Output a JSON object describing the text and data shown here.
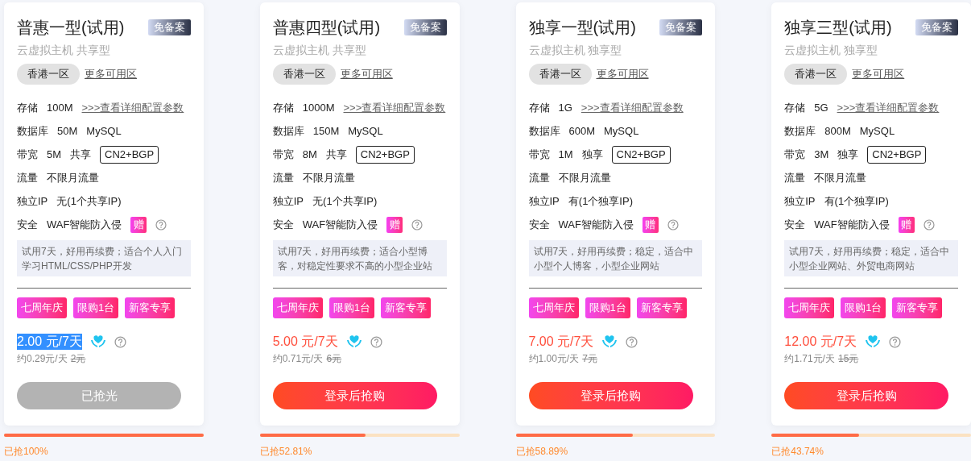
{
  "plans": [
    {
      "title": "普惠一型(试用)",
      "badge": "免备案",
      "subtitle": "云虚拟主机 共享型",
      "zone": "香港一区",
      "more_zones": "更多可用区",
      "specs": [
        {
          "label": "存储",
          "values": [
            "100M"
          ],
          "link": ">>>查看详细配置参数"
        },
        {
          "label": "数据库",
          "values": [
            "50M",
            "MySQL"
          ]
        },
        {
          "label": "带宽",
          "values": [
            "5M",
            "共享"
          ],
          "tag": "CN2+BGP"
        },
        {
          "label": "流量",
          "values": [
            "不限月流量"
          ]
        },
        {
          "label": "独立IP",
          "values": [
            "无(1个共享IP)"
          ]
        },
        {
          "label": "安全",
          "values": [
            "WAF智能防入侵"
          ],
          "gift": "赠"
        }
      ],
      "description": "试用7天，好用再续费；适合个人入门学习HTML/CSS/PHP开发",
      "promo_tags": [
        "七周年庆",
        "限购1台",
        "新客专享"
      ],
      "price": "2.00 元/7天",
      "price_selected": true,
      "per_day": "约0.29元/天",
      "original_price": "2元",
      "button": "已抢光",
      "sold_out": true,
      "level": 1,
      "sold_text": "已抢100%"
    },
    {
      "title": "普惠四型(试用)",
      "badge": "免备案",
      "subtitle": "云虚拟主机 共享型",
      "zone": "香港一区",
      "more_zones": "更多可用区",
      "specs": [
        {
          "label": "存储",
          "values": [
            "1000M"
          ],
          "link": ">>>查看详细配置参数"
        },
        {
          "label": "数据库",
          "values": [
            "150M",
            "MySQL"
          ]
        },
        {
          "label": "带宽",
          "values": [
            "8M",
            "共享"
          ],
          "tag": "CN2+BGP"
        },
        {
          "label": "流量",
          "values": [
            "不限月流量"
          ]
        },
        {
          "label": "独立IP",
          "values": [
            "无(1个共享IP)"
          ]
        },
        {
          "label": "安全",
          "values": [
            "WAF智能防入侵"
          ],
          "gift": "赠"
        }
      ],
      "description": "试用7天，好用再续费；适合小型博客，对稳定性要求不高的小型企业站",
      "promo_tags": [
        "七周年庆",
        "限购1台",
        "新客专享"
      ],
      "price": "5.00 元/7天",
      "price_selected": false,
      "per_day": "约0.71元/天",
      "original_price": "6元",
      "button": "登录后抢购",
      "sold_out": false,
      "level": 0.5281,
      "sold_text": "已抢52.81%"
    },
    {
      "title": "独享一型(试用)",
      "badge": "免备案",
      "subtitle": "云虚拟主机 独享型",
      "zone": "香港一区",
      "more_zones": "更多可用区",
      "specs": [
        {
          "label": "存储",
          "values": [
            "1G"
          ],
          "link": ">>>查看详细配置参数"
        },
        {
          "label": "数据库",
          "values": [
            "600M",
            "MySQL"
          ]
        },
        {
          "label": "带宽",
          "values": [
            "1M",
            "独享"
          ],
          "tag": "CN2+BGP"
        },
        {
          "label": "流量",
          "values": [
            "不限月流量"
          ]
        },
        {
          "label": "独立IP",
          "values": [
            "有(1个独享IP)"
          ]
        },
        {
          "label": "安全",
          "values": [
            "WAF智能防入侵"
          ],
          "gift": "赠"
        }
      ],
      "description": "试用7天，好用再续费；稳定，适合中小型个人博客，小型企业网站",
      "promo_tags": [
        "七周年庆",
        "限购1台",
        "新客专享"
      ],
      "price": "7.00 元/7天",
      "price_selected": false,
      "per_day": "约1.00元/天",
      "original_price": "7元",
      "button": "登录后抢购",
      "sold_out": false,
      "level": 0.5889,
      "sold_text": "已抢58.89%"
    },
    {
      "title": "独享三型(试用)",
      "badge": "免备案",
      "subtitle": "云虚拟主机 独享型",
      "zone": "香港一区",
      "more_zones": "更多可用区",
      "specs": [
        {
          "label": "存储",
          "values": [
            "5G"
          ],
          "link": ">>>查看详细配置参数"
        },
        {
          "label": "数据库",
          "values": [
            "800M",
            "MySQL"
          ]
        },
        {
          "label": "带宽",
          "values": [
            "3M",
            "独享"
          ],
          "tag": "CN2+BGP"
        },
        {
          "label": "流量",
          "values": [
            "不限月流量"
          ]
        },
        {
          "label": "独立IP",
          "values": [
            "有(1个独享IP)"
          ]
        },
        {
          "label": "安全",
          "values": [
            "WAF智能防入侵"
          ],
          "gift": "赠"
        }
      ],
      "description": "试用7天，好用再续费；稳定，适合中小型企业网站、外贸电商网站",
      "promo_tags": [
        "七周年庆",
        "限购1台",
        "新客专享"
      ],
      "price": "12.00 元/7天",
      "price_selected": false,
      "per_day": "约1.71元/天",
      "original_price": "15元",
      "button": "登录后抢购",
      "sold_out": false,
      "level": 0.4374,
      "sold_text": "已抢43.74%"
    }
  ]
}
